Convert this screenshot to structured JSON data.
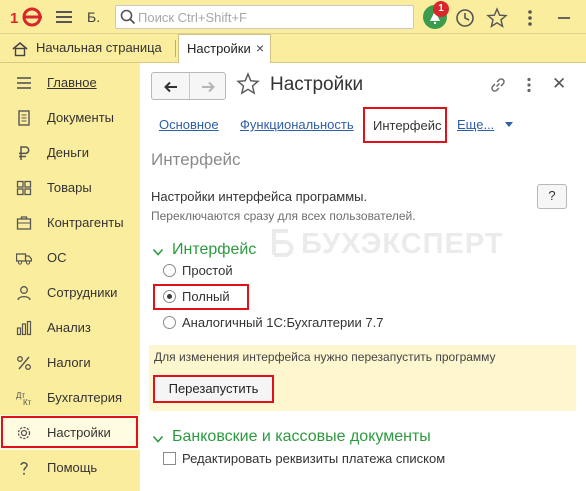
{
  "topbar": {
    "logo_text": "1С",
    "app_letter": "Б.",
    "search_placeholder": "Поиск Ctrl+Shift+F",
    "notification_count": "1"
  },
  "tabs": {
    "home_label": "Начальная страница",
    "active_label": "Настройки",
    "close_glyph": "×"
  },
  "sidebar": {
    "items": [
      {
        "label": "Главное",
        "icon": "menu-icon"
      },
      {
        "label": "Документы",
        "icon": "document-icon"
      },
      {
        "label": "Деньги",
        "icon": "ruble-icon"
      },
      {
        "label": "Товары",
        "icon": "goods-icon"
      },
      {
        "label": "Контрагенты",
        "icon": "contractors-icon"
      },
      {
        "label": "ОС",
        "icon": "truck-icon"
      },
      {
        "label": "Сотрудники",
        "icon": "person-icon"
      },
      {
        "label": "Анализ",
        "icon": "chart-icon"
      },
      {
        "label": "Налоги",
        "icon": "percent-icon"
      },
      {
        "label": "Бухгалтерия",
        "icon": "accounting-icon"
      },
      {
        "label": "Настройки",
        "icon": "gear-icon"
      },
      {
        "label": "Помощь",
        "icon": "question-icon"
      }
    ]
  },
  "page": {
    "title": "Настройки",
    "section_tabs": [
      "Основное",
      "Функциональность",
      "Интерфейс",
      "Еще..."
    ],
    "active_section": "Интерфейс",
    "heading": "Интерфейс",
    "description": "Настройки интерфейса программы.",
    "subdescription": "Переключаются сразу для всех пользователей.",
    "help_label": "?",
    "watermark": "БУХЭКСПЕРТ",
    "interface_group": {
      "title": "Интерфейс",
      "options": [
        "Простой",
        "Полный",
        "Аналогичный 1С:Бухгалтерии 7.7"
      ],
      "selected": "Полный"
    },
    "notice": {
      "text": "Для изменения интерфейса нужно перезапустить программу",
      "button_label": "Перезапустить"
    },
    "bank_group": {
      "title": "Банковские и кассовые документы",
      "checkbox_label": "Редактировать реквизиты платежа списком",
      "checked": false
    }
  },
  "colors": {
    "background": "#fbed9e",
    "link": "#2e5ea8",
    "group_title": "#2c9a3f",
    "highlight_box": "#e0111b",
    "notice_bg": "#fdf6cf"
  }
}
